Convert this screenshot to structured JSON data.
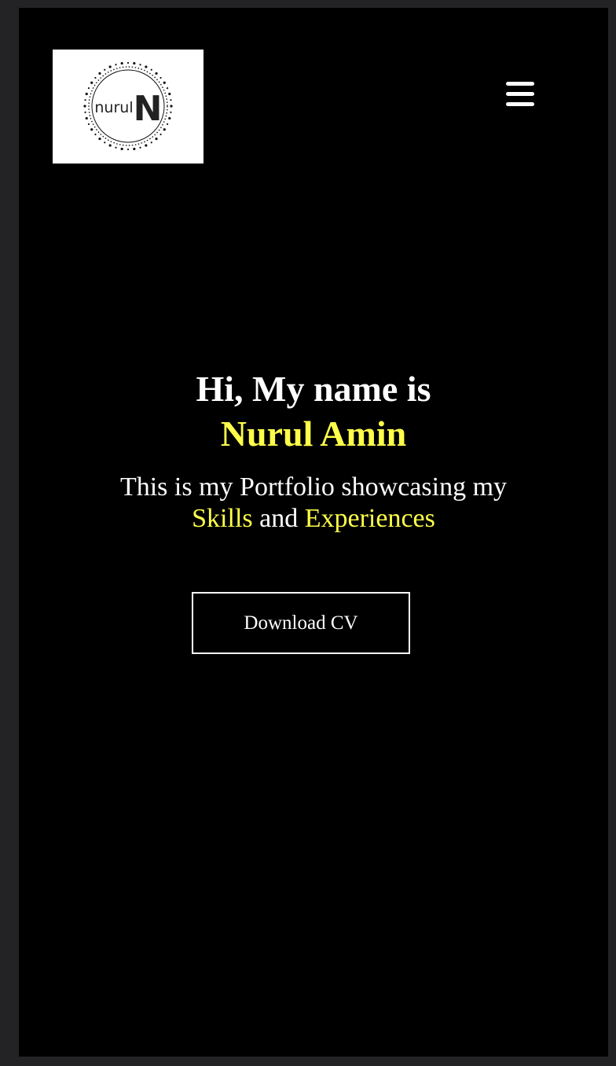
{
  "header": {
    "logo_text": "nurul",
    "logo_letter": "N",
    "menu_icon": "hamburger-menu-icon"
  },
  "hero": {
    "greeting": "Hi, My name is",
    "name": "Nurul Amin",
    "subtitle_prefix": "This is my Portfolio showcasing my",
    "subtitle_skills": "Skills",
    "subtitle_and": "and",
    "subtitle_experiences": "Experiences",
    "cv_button_label": "Download CV"
  },
  "colors": {
    "background": "#000000",
    "accent": "#ffff4a",
    "text": "#ffffff",
    "frame": "#232325"
  }
}
